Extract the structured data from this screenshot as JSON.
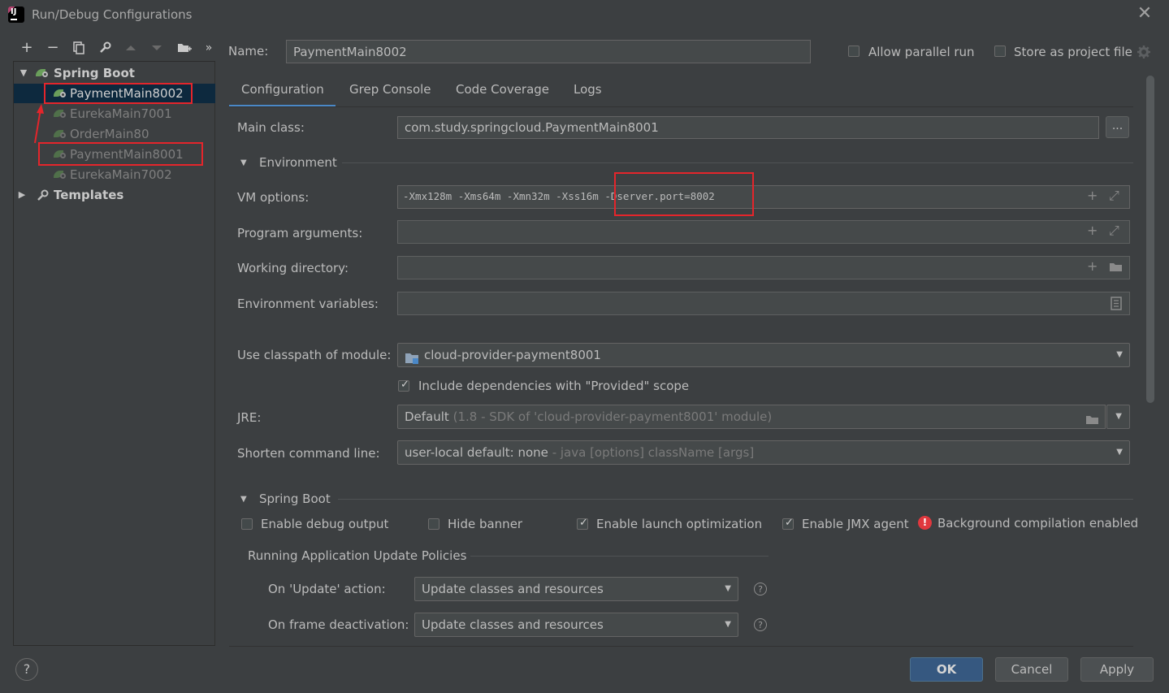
{
  "window": {
    "title": "Run/Debug Configurations",
    "close_icon": "close-icon"
  },
  "toolbar": {
    "add": "+",
    "remove": "−",
    "copy_icon": "copy-icon",
    "settings_icon": "wrench-icon",
    "up_icon": "arrow-up-icon",
    "down_icon": "arrow-down-icon",
    "folder_icon": "new-folder-icon",
    "more": "»"
  },
  "tree": {
    "group_label": "Spring Boot",
    "items": [
      {
        "label": "PaymentMain8002",
        "selected": true
      },
      {
        "label": "EurekaMain7001"
      },
      {
        "label": "OrderMain80"
      },
      {
        "label": "PaymentMain8001"
      },
      {
        "label": "EurekaMain7002"
      }
    ],
    "templates_label": "Templates"
  },
  "header": {
    "name_label": "Name:",
    "name_value": "PaymentMain8002",
    "allow_parallel_label": "Allow parallel run",
    "store_project_label": "Store as project file"
  },
  "tabs": [
    "Configuration",
    "Grep Console",
    "Code Coverage",
    "Logs"
  ],
  "config": {
    "main_class_label": "Main class:",
    "main_class_value": "com.study.springcloud.PaymentMain8001",
    "browse_label": "...",
    "environment_label": "Environment",
    "vm_options_label": "VM options:",
    "vm_options_value": "-Xmx128m -Xms64m -Xmn32m -Xss16m -Dserver.port=8002",
    "program_args_label": "Program arguments:",
    "working_dir_label": "Working directory:",
    "env_vars_label": "Environment variables:",
    "classpath_label": "Use classpath of module:",
    "classpath_value": "cloud-provider-payment8001",
    "include_deps_label": "Include dependencies with \"Provided\" scope",
    "jre_label": "JRE:",
    "jre_value": "Default",
    "jre_hint": "(1.8 - SDK of 'cloud-provider-payment8001' module)",
    "shorten_label": "Shorten command line:",
    "shorten_value": "user-local default: none",
    "shorten_hint": "- java [options] className [args]"
  },
  "spring_boot": {
    "section_label": "Spring Boot",
    "debug_output_label": "Enable debug output",
    "hide_banner_label": "Hide banner",
    "launch_opt_label": "Enable launch optimization",
    "jmx_label": "Enable JMX agent",
    "bg_compile_label": "Background compilation enabled",
    "policies_label": "Running Application Update Policies",
    "on_update_label": "On 'Update' action:",
    "on_update_value": "Update classes and resources",
    "on_frame_label": "On frame deactivation:",
    "on_frame_value": "Update classes and resources"
  },
  "footer": {
    "help": "?",
    "ok": "OK",
    "cancel": "Cancel",
    "apply": "Apply"
  }
}
